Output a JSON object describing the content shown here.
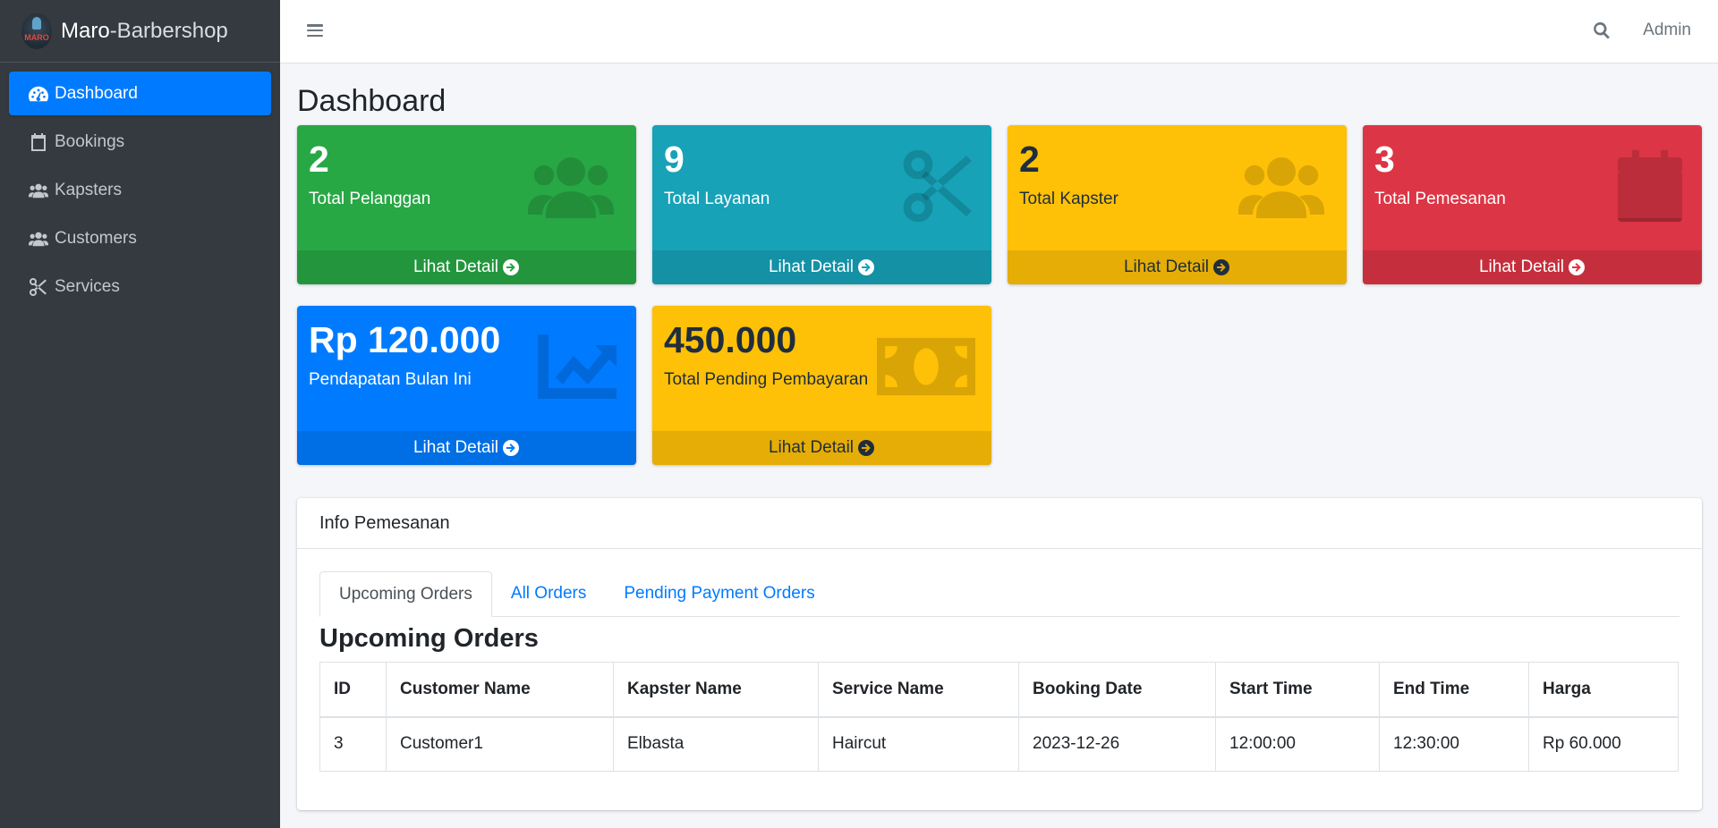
{
  "brand": {
    "name_bold": "Maro",
    "name_light": "-Barbershop",
    "logo_text": "MARO"
  },
  "sidebar": {
    "items": [
      {
        "label": "Dashboard",
        "icon": "dashboard-icon",
        "active": true
      },
      {
        "label": "Bookings",
        "icon": "calendar-icon"
      },
      {
        "label": "Kapsters",
        "icon": "users-icon"
      },
      {
        "label": "Customers",
        "icon": "users-icon"
      },
      {
        "label": "Services",
        "icon": "scissors-icon"
      }
    ]
  },
  "topbar": {
    "user": "Admin"
  },
  "page": {
    "title": "Dashboard"
  },
  "cards": [
    {
      "value": "2",
      "label": "Total Pelanggan",
      "footer": "Lihat Detail",
      "color": "#28a745",
      "icon": "users-icon"
    },
    {
      "value": "9",
      "label": "Total Layanan",
      "footer": "Lihat Detail",
      "color": "#17a2b8",
      "icon": "scissors-icon"
    },
    {
      "value": "2",
      "label": "Total Kapster",
      "footer": "Lihat Detail",
      "color": "#ffc107",
      "icon": "users-icon"
    },
    {
      "value": "3",
      "label": "Total Pemesanan",
      "footer": "Lihat Detail",
      "color": "#dc3545",
      "icon": "calendar-icon"
    },
    {
      "value": "Rp 120.000",
      "label": "Pendapatan Bulan Ini",
      "footer": "Lihat Detail",
      "color": "#007bff",
      "icon": "chart-line-icon"
    },
    {
      "value": "450.000",
      "label": "Total Pending Pembayaran",
      "footer": "Lihat Detail",
      "color": "#ffc107",
      "icon": "money-bill-icon"
    }
  ],
  "info": {
    "title": "Info Pemesanan",
    "tabs": [
      "Upcoming Orders",
      "All Orders",
      "Pending Payment Orders"
    ],
    "section_title": "Upcoming Orders",
    "columns": [
      "ID",
      "Customer Name",
      "Kapster Name",
      "Service Name",
      "Booking Date",
      "Start Time",
      "End Time",
      "Harga"
    ],
    "rows": [
      [
        "3",
        "Customer1",
        "Elbasta",
        "Haircut",
        "2023-12-26",
        "12:00:00",
        "12:30:00",
        "Rp 60.000"
      ]
    ]
  }
}
